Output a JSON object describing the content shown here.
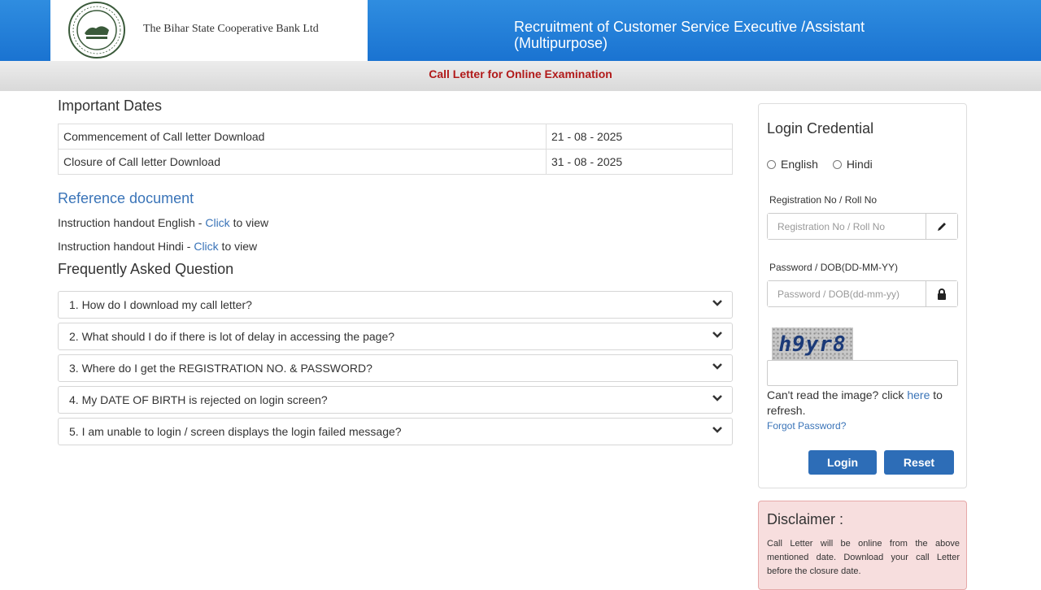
{
  "header": {
    "bank_name": "The Bihar State Cooperative Bank Ltd",
    "title": "Recruitment of Customer Service Executive /Assistant (Multipurpose)",
    "subtitle": "Call Letter for Online Examination"
  },
  "important_dates": {
    "heading": "Important Dates",
    "rows": [
      {
        "label": "Commencement of Call letter Download",
        "value": "21 - 08 - 2025"
      },
      {
        "label": "Closure of Call letter Download",
        "value": "31 - 08 - 2025"
      }
    ]
  },
  "reference": {
    "heading": "Reference document",
    "items": [
      {
        "prefix": "Instruction handout English - ",
        "link": "Click",
        "suffix": " to view"
      },
      {
        "prefix": "Instruction handout Hindi - ",
        "link": "Click",
        "suffix": " to view"
      }
    ]
  },
  "faq": {
    "heading": "Frequently Asked Question",
    "items": [
      "1. How do I download my call letter?",
      "2. What should I do if there is lot of delay in accessing the page?",
      "3. Where do I get the REGISTRATION NO. & PASSWORD?",
      "4. My DATE OF BIRTH is rejected on login screen?",
      "5. I am unable to login / screen displays the login failed message?"
    ]
  },
  "login": {
    "title": "Login Credential",
    "language_options": [
      "English",
      "Hindi"
    ],
    "reg_label": "Registration No / Roll No",
    "reg_placeholder": "Registration No / Roll No",
    "pwd_label": "Password / DOB(DD-MM-YY)",
    "pwd_placeholder": "Password / DOB(dd-mm-yy)",
    "captcha_text": "h9yr8",
    "cant_read_prefix": "Can't read the image? click ",
    "cant_read_link": "here",
    "cant_read_suffix": " to refresh.",
    "forgot": "Forgot Password?",
    "login_button": "Login",
    "reset_button": "Reset"
  },
  "disclaimer": {
    "title": "Disclaimer :",
    "text": "Call Letter will be online from the above mentioned date. Download your call Letter before the closure date."
  },
  "icons": {
    "pencil": "pencil-icon",
    "lock": "lock-icon",
    "chevron": "chevron-down-icon"
  },
  "colors": {
    "header_blue": "#1a73d1",
    "subtitle_red": "#b11a1a",
    "link_blue": "#3a74b8",
    "button_blue": "#2d6db7",
    "disclaimer_bg": "#f7dede"
  }
}
